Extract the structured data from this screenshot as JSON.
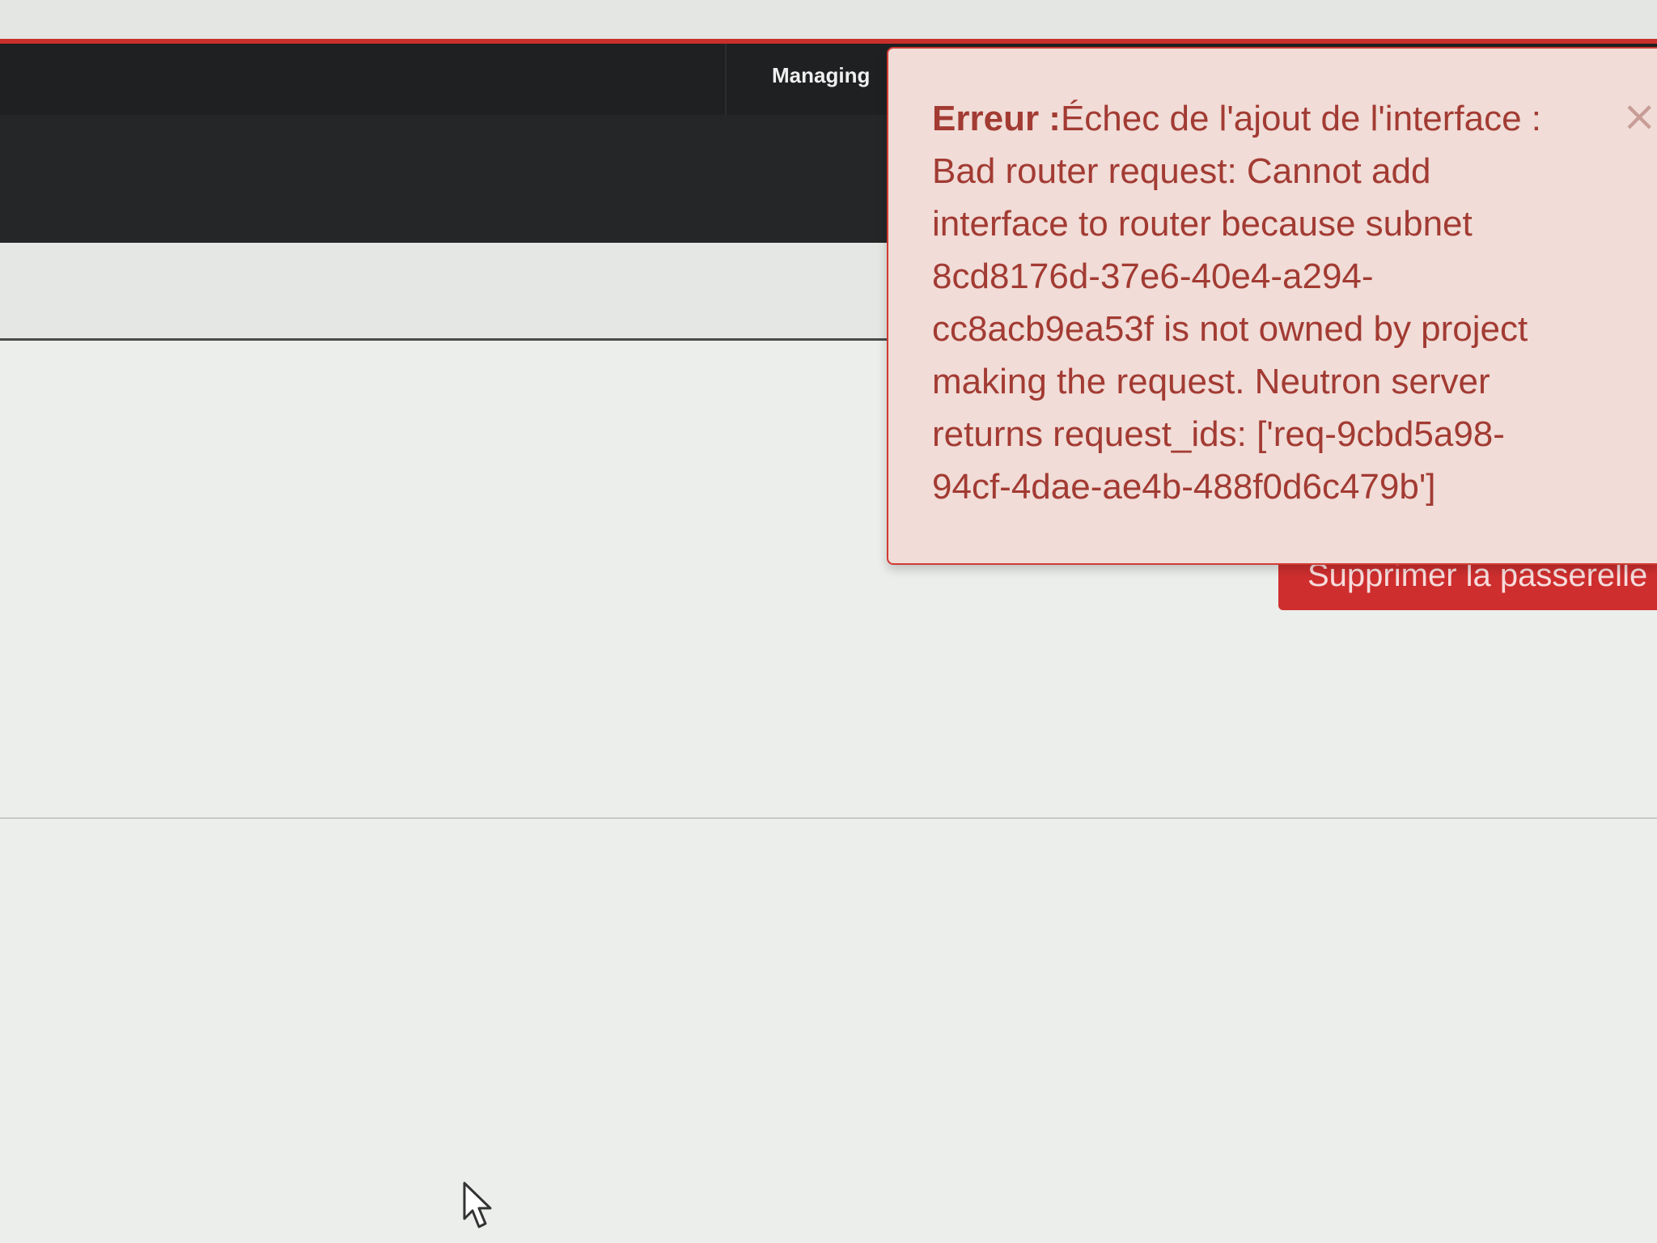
{
  "header": {
    "project_label": "Managing"
  },
  "alert": {
    "title": "Erreur :",
    "message": "Échec de l'ajout de l'interface : Bad router request: Cannot add interface to router because subnet 8cd8176d-37e6-40e4-a294-cc8acb9ea53f is not owned by project making the request. Neutron server returns request_ids: ['req-9cbd5a98-94cf-4dae-ae4b-488f0d6c479b']",
    "close_symbol": "×"
  },
  "actions": {
    "delete_gateway_label": "Supprimer la passerelle"
  },
  "colors": {
    "accent": "#c8302c",
    "navbar": "#1f2021",
    "alert_background": "#f1dcd7",
    "alert_text": "#a23b33",
    "danger_button": "#cf2e2e"
  },
  "icons": {
    "cursor": "mouse-pointer-icon",
    "close": "close-icon"
  }
}
